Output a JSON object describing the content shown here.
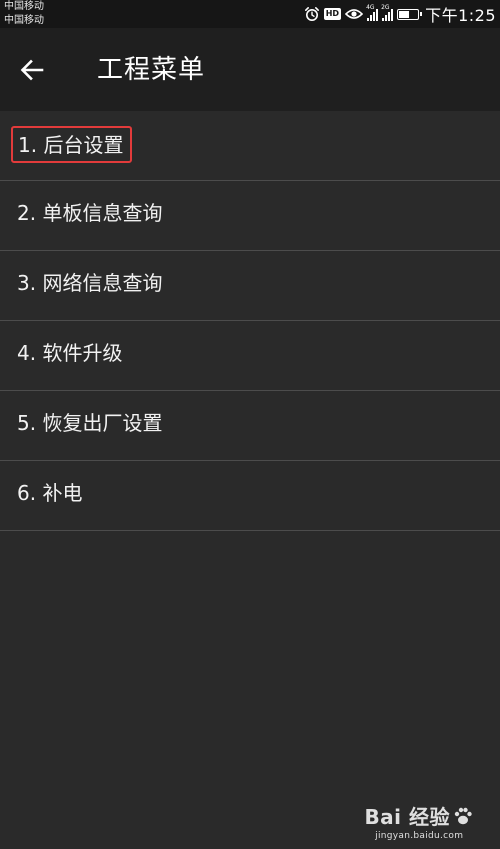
{
  "status_bar": {
    "carriers": [
      "中国移动",
      "中国移动"
    ],
    "hd_badge": "HD",
    "signal_tags": [
      "4G",
      "2G"
    ],
    "battery_level": 0.6,
    "time": "下午1:25",
    "icons": [
      "alarm-icon",
      "hd-icon",
      "eye-icon",
      "signal-icon",
      "signal-icon",
      "battery-icon"
    ]
  },
  "app_bar": {
    "back_icon": "arrow-left-icon",
    "title": "工程菜单"
  },
  "menu": {
    "items": [
      {
        "label": "1. 后台设置",
        "highlighted": true
      },
      {
        "label": "2. 单板信息查询",
        "highlighted": false
      },
      {
        "label": "3. 网络信息查询",
        "highlighted": false
      },
      {
        "label": "4. 软件升级",
        "highlighted": false
      },
      {
        "label": "5. 恢复出厂设置",
        "highlighted": false
      },
      {
        "label": "6. 补电",
        "highlighted": false
      }
    ]
  },
  "watermark": {
    "logo_text": "Bai 经验",
    "site": "jingyan.baidu.com"
  },
  "colors": {
    "background": "#2a2a2a",
    "app_bar": "#1f1f1f",
    "status_bar": "#161616",
    "divider": "#4c4c4c",
    "highlight_border": "#e23b3b"
  }
}
